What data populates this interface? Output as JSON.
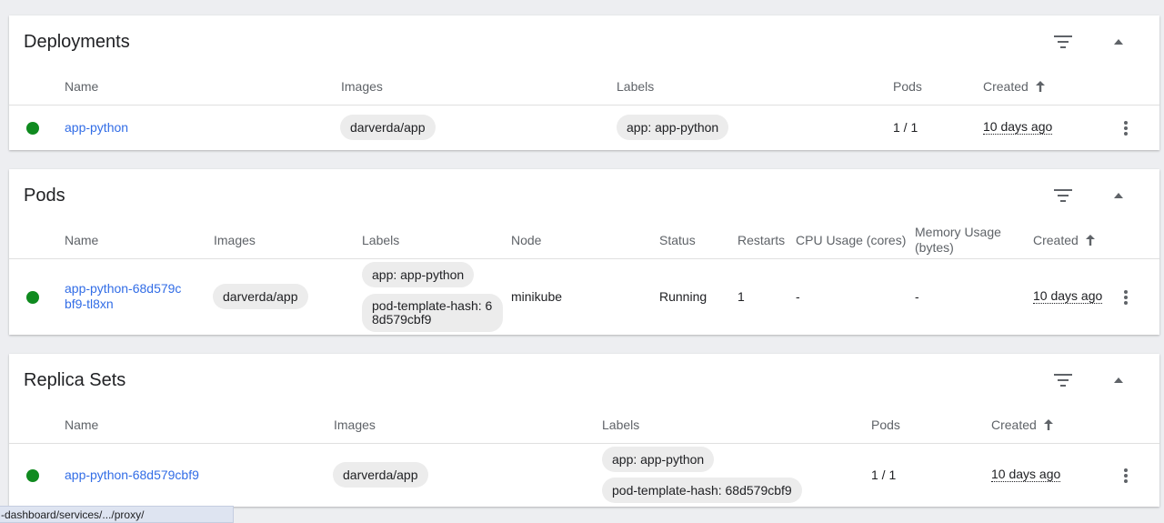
{
  "icons": {
    "filter": "filter-icon",
    "collapse": "chevron-up-icon",
    "menu": "more-vert-icon",
    "sort": "arrow-up-icon",
    "status": "status-dot"
  },
  "colors": {
    "accent": "#326de6",
    "success": "#0f8a1f"
  },
  "deployments": {
    "title": "Deployments",
    "headers": {
      "name": "Name",
      "images": "Images",
      "labels": "Labels",
      "pods": "Pods",
      "created": "Created"
    },
    "rows": [
      {
        "name": "app-python",
        "image": "darverda/app",
        "labels": [
          "app: app-python"
        ],
        "pods": "1 / 1",
        "created": "10 days ago"
      }
    ]
  },
  "pods": {
    "title": "Pods",
    "headers": {
      "name": "Name",
      "images": "Images",
      "labels": "Labels",
      "node": "Node",
      "status": "Status",
      "restarts": "Restarts",
      "cpu": "CPU Usage (cores)",
      "memory": "Memory Usage (bytes)",
      "created": "Created"
    },
    "rows": [
      {
        "name": "app-python-68d579cbf9-tl8xn",
        "image": "darverda/app",
        "labels": [
          "app: app-python",
          "pod-template-hash: 68d579cbf9"
        ],
        "node": "minikube",
        "status": "Running",
        "restarts": "1",
        "cpu": "-",
        "memory": "-",
        "created": "10 days ago"
      }
    ]
  },
  "replicasets": {
    "title": "Replica Sets",
    "headers": {
      "name": "Name",
      "images": "Images",
      "labels": "Labels",
      "pods": "Pods",
      "created": "Created"
    },
    "rows": [
      {
        "name": "app-python-68d579cbf9",
        "image": "darverda/app",
        "labels": [
          "app: app-python",
          "pod-template-hash: 68d579cbf9"
        ],
        "pods": "1 / 1",
        "created": "10 days ago"
      }
    ]
  },
  "statusbar": {
    "url": "-dashboard/services/.../proxy/"
  }
}
